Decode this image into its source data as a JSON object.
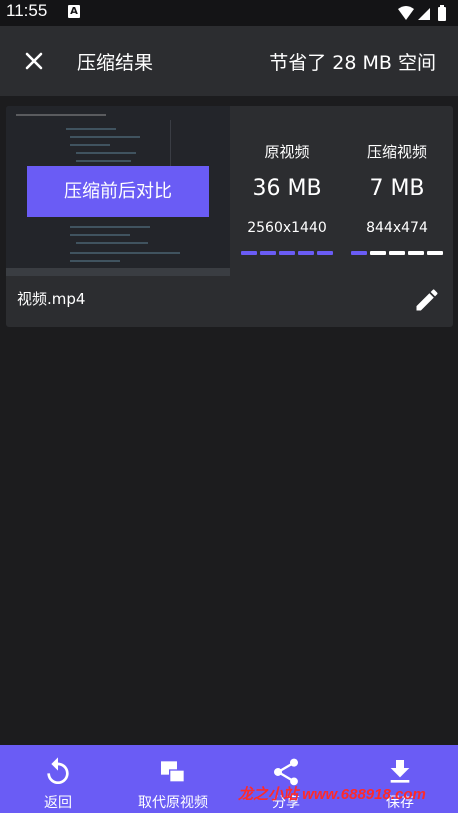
{
  "status_bar": {
    "time": "11:55",
    "notification_icon": "A"
  },
  "app_bar": {
    "close_icon": "close-icon",
    "title": "压缩结果",
    "saved_text": "节省了 28 MB 空间"
  },
  "result_card": {
    "compare_label": "压缩前后对比",
    "original": {
      "label": "原视频",
      "size": "36 MB",
      "resolution": "2560x1440",
      "bar_fill": 5
    },
    "compressed": {
      "label": "压缩视频",
      "size": "7 MB",
      "resolution": "844x474",
      "bar_fill": 1
    },
    "bar_segments": 5,
    "file_name": "视频.mp4",
    "edit_icon": "pencil-icon"
  },
  "bottom_nav": [
    {
      "label": "返回",
      "icon": "undo-icon"
    },
    {
      "label": "取代原视频",
      "icon": "replace-icon"
    },
    {
      "label": "分享",
      "icon": "share-icon"
    },
    {
      "label": "保存",
      "icon": "download-icon"
    }
  ],
  "watermark": "龙之小站 www.688918.com",
  "colors": {
    "accent": "#6a5cf5",
    "background": "#1c1c1e",
    "surface": "#2c2d30",
    "bar_empty": "#ffffff"
  }
}
